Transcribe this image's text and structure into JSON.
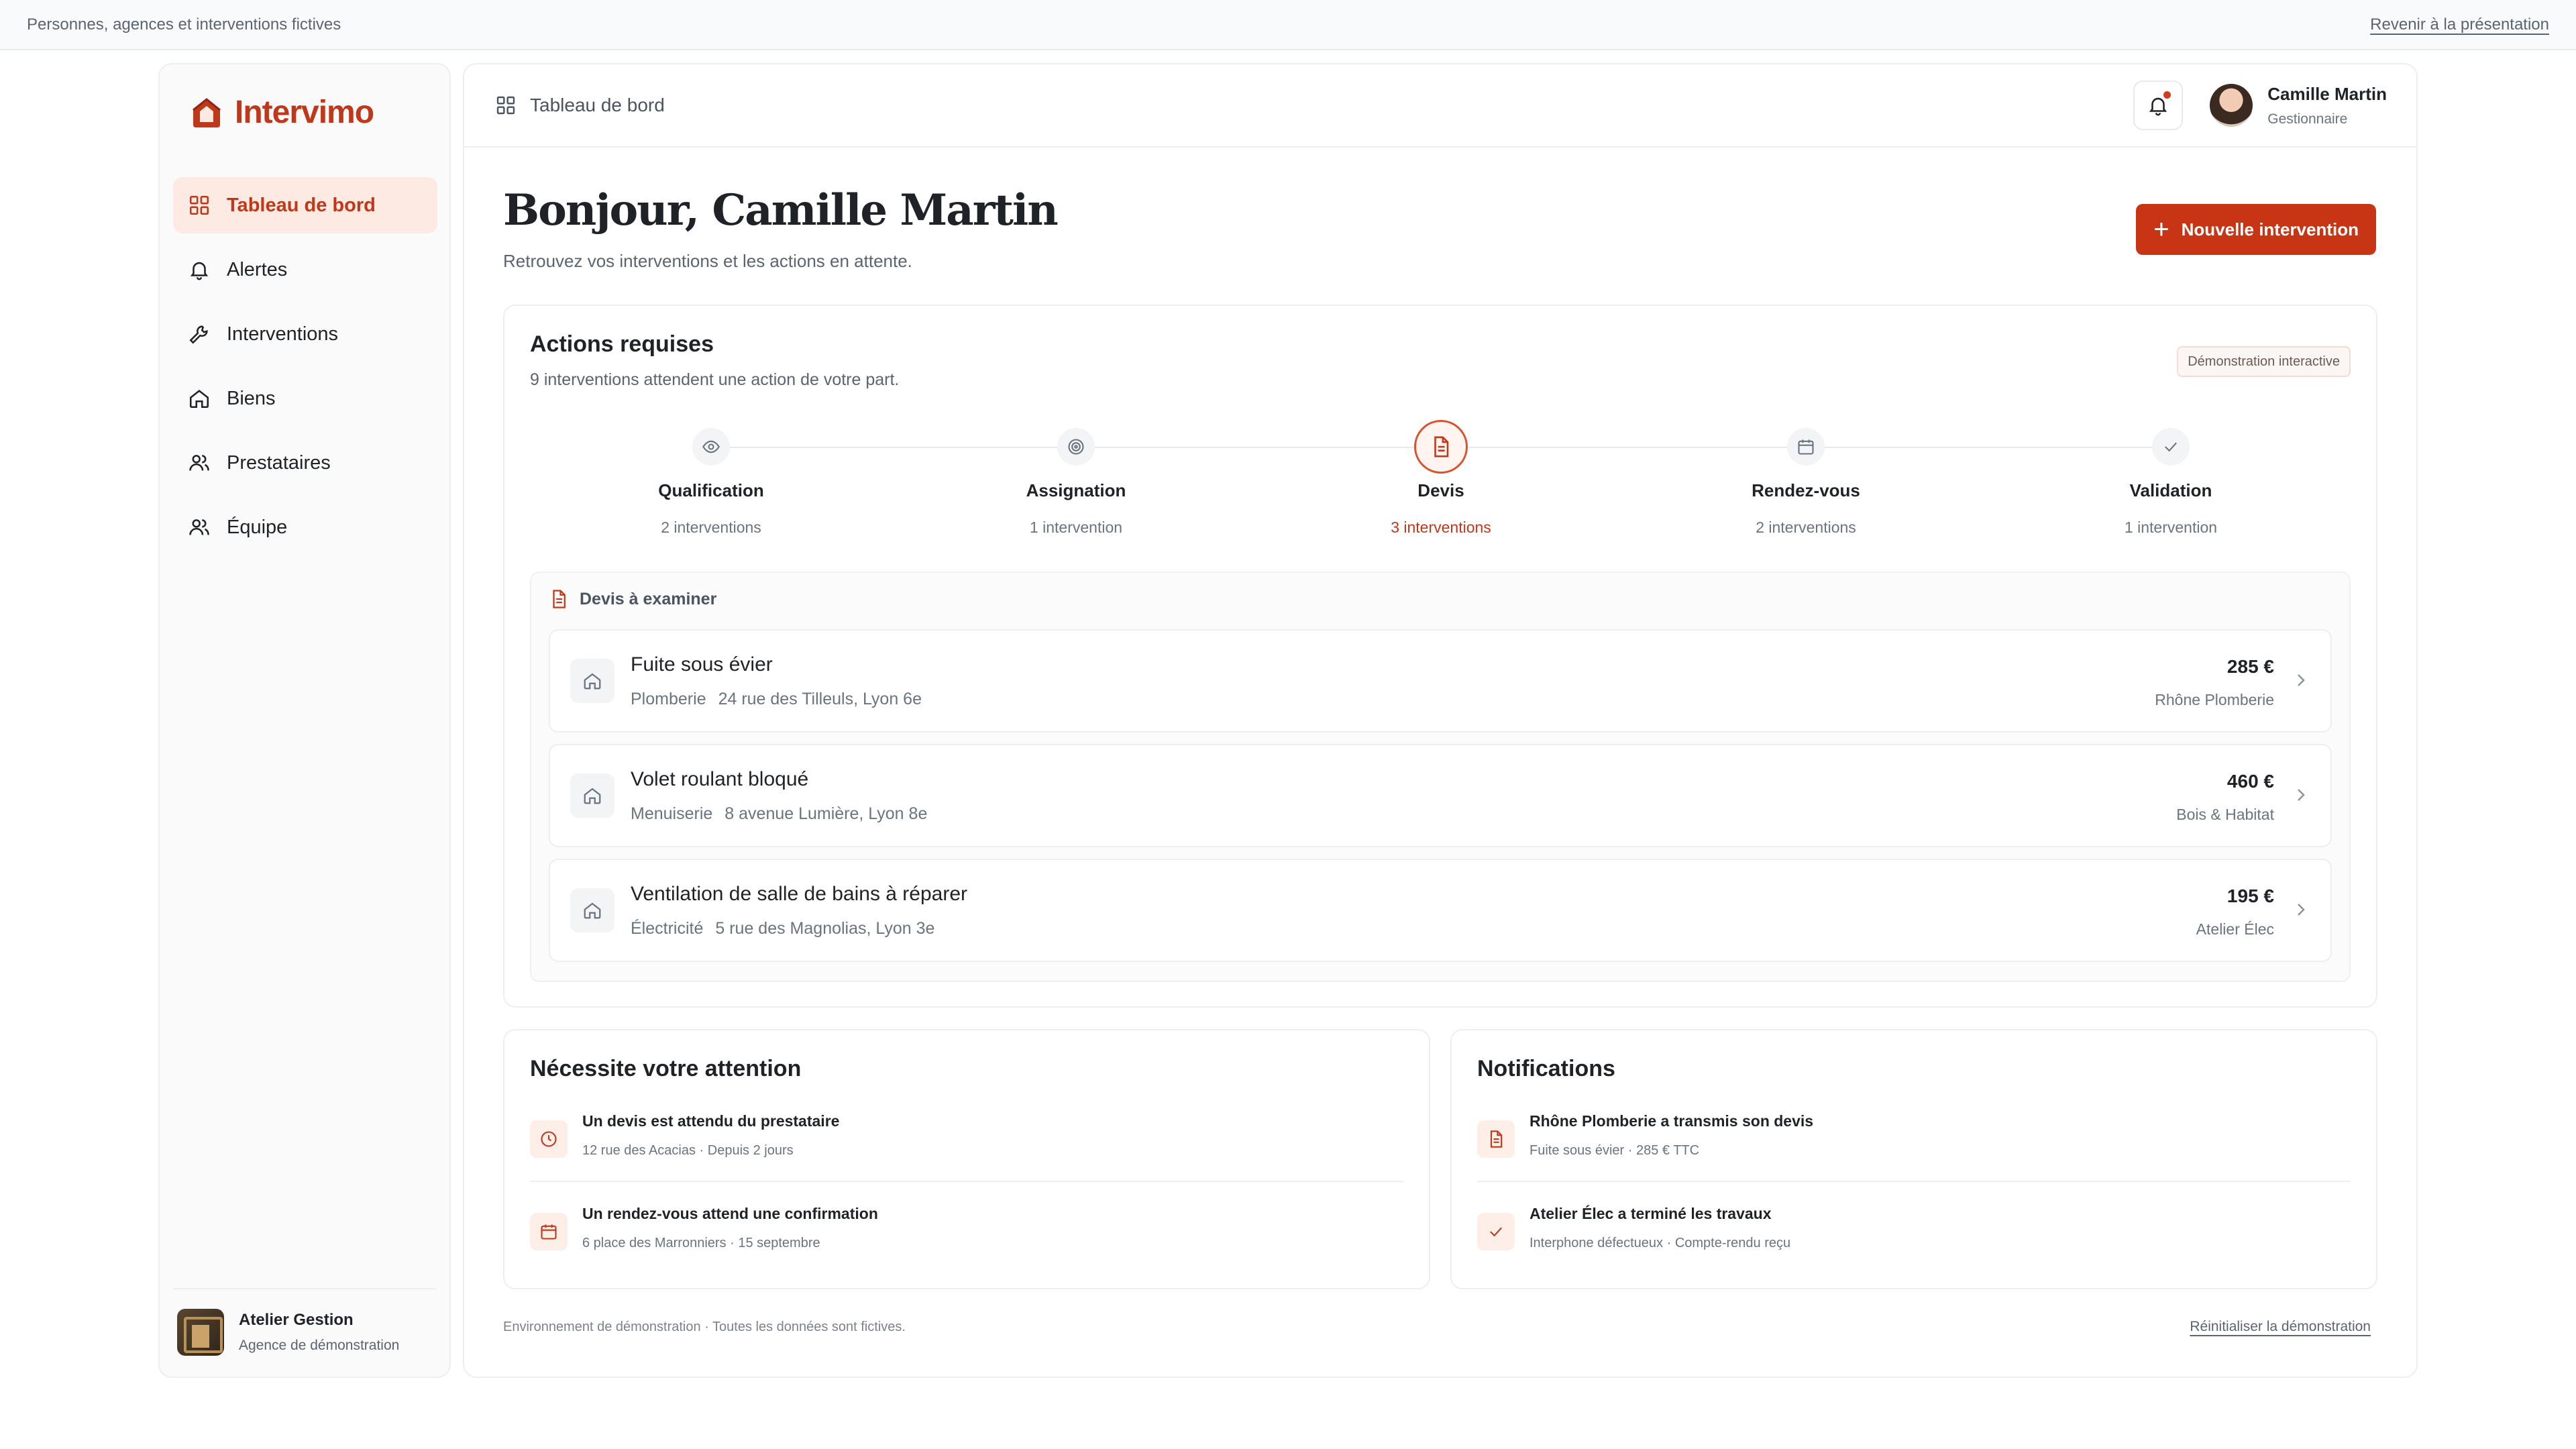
{
  "banner": {
    "disclaimer": "Personnes, agences et interventions fictives",
    "back_link": "Revenir à la présentation"
  },
  "brand": {
    "name": "Intervimo",
    "color": "#c0381a"
  },
  "sidebar": {
    "items": [
      {
        "label": "Tableau de bord",
        "icon": "grid-icon",
        "active": true
      },
      {
        "label": "Alertes",
        "icon": "bell-icon"
      },
      {
        "label": "Interventions",
        "icon": "wrench-icon"
      },
      {
        "label": "Biens",
        "icon": "home-icon"
      },
      {
        "label": "Prestataires",
        "icon": "users-icon"
      },
      {
        "label": "Équipe",
        "icon": "users-icon"
      }
    ],
    "agency": {
      "name": "Atelier Gestion",
      "subtitle": "Agence de démonstration"
    }
  },
  "header": {
    "breadcrumb": "Tableau de bord",
    "user": {
      "name": "Camille Martin",
      "role": "Gestionnaire"
    }
  },
  "page": {
    "greeting": "Bonjour, Camille Martin",
    "subtitle": "Retrouvez vos interventions et les actions en attente.",
    "new_button": "Nouvelle intervention"
  },
  "actions": {
    "title": "Actions requises",
    "subtitle": "9 interventions attendent une action de votre part.",
    "badge": "Démonstration interactive",
    "steps": [
      {
        "label": "Qualification",
        "count": "2 interventions",
        "icon": "eye-icon"
      },
      {
        "label": "Assignation",
        "count": "1 intervention",
        "icon": "target-icon"
      },
      {
        "label": "Devis",
        "count": "3 interventions",
        "icon": "document-icon",
        "active": true
      },
      {
        "label": "Rendez-vous",
        "count": "2 interventions",
        "icon": "calendar-icon"
      },
      {
        "label": "Validation",
        "count": "1 intervention",
        "icon": "check-icon"
      }
    ],
    "quotes_heading": "Devis à examiner",
    "quotes": [
      {
        "title": "Fuite sous évier",
        "category": "Plomberie",
        "address": "24 rue des Tilleuls, Lyon 6e",
        "amount": "285 €",
        "provider": "Rhône Plomberie"
      },
      {
        "title": "Volet roulant bloqué",
        "category": "Menuiserie",
        "address": "8 avenue Lumière, Lyon 8e",
        "amount": "460 €",
        "provider": "Bois & Habitat"
      },
      {
        "title": "Ventilation de salle de bains à réparer",
        "category": "Électricité",
        "address": "5 rue des Magnolias, Lyon 3e",
        "amount": "195 €",
        "provider": "Atelier Élec"
      }
    ]
  },
  "attention": {
    "title": "Nécessite votre attention",
    "items": [
      {
        "title": "Un devis est attendu du prestataire",
        "sub": "12 rue des Acacias · Depuis 2 jours",
        "icon": "clock-icon"
      },
      {
        "title": "Un rendez-vous attend une confirmation",
        "sub": "6 place des Marronniers · 15 septembre",
        "icon": "calendar-icon"
      }
    ]
  },
  "notifications": {
    "title": "Notifications",
    "items": [
      {
        "title": "Rhône Plomberie a transmis son devis",
        "sub": "Fuite sous évier · 285 € TTC",
        "icon": "document-icon"
      },
      {
        "title": "Atelier Élec a terminé les travaux",
        "sub": "Interphone défectueux · Compte-rendu reçu",
        "icon": "check-icon"
      }
    ]
  },
  "footer": {
    "note": "Environnement de démonstration · Toutes les données sont fictives.",
    "reset": "Réinitialiser la démonstration"
  }
}
